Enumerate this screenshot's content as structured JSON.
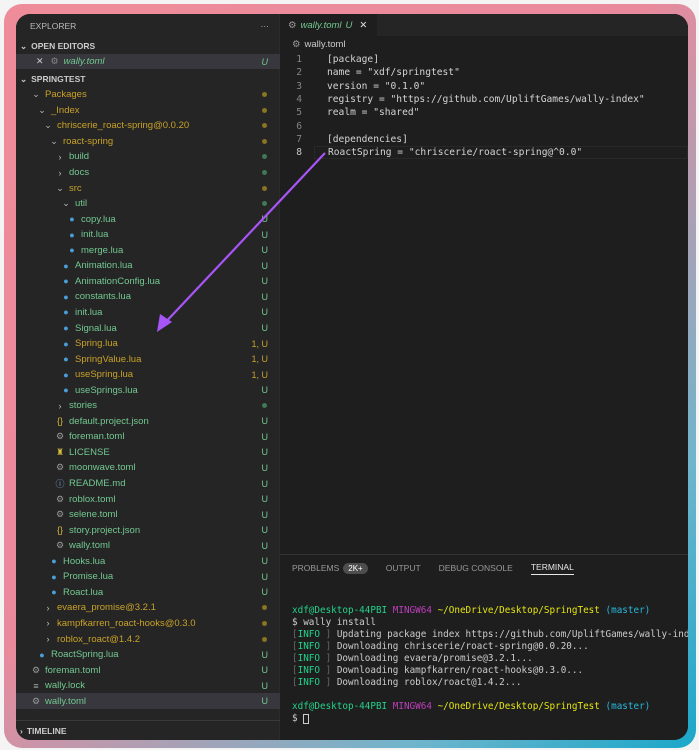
{
  "sidebar": {
    "title": "EXPLORER",
    "more": "···",
    "open_editors": "OPEN EDITORS",
    "open_file": {
      "name": "wally.toml",
      "badge": "U"
    },
    "workspace": "SPRINGTEST",
    "timeline": "TIMELINE",
    "tree": [
      {
        "name": "Packages",
        "lvl": 1,
        "kind": "folder-open",
        "color": "#c9a227",
        "dot": "#8a7420"
      },
      {
        "name": "_Index",
        "lvl": 2,
        "kind": "folder-open",
        "color": "#c9a227",
        "dot": "#8a7420"
      },
      {
        "name": "chriscerie_roact-spring@0.0.20",
        "lvl": 3,
        "kind": "folder-open",
        "color": "#c9a227",
        "dot": "#8a7420"
      },
      {
        "name": "roact-spring",
        "lvl": 4,
        "kind": "folder-open",
        "color": "#c9a227",
        "dot": "#8a7420"
      },
      {
        "name": "build",
        "lvl": 5,
        "kind": "folder",
        "color": "#73c991",
        "dot": "#3f7a55"
      },
      {
        "name": "docs",
        "lvl": 5,
        "kind": "folder",
        "color": "#73c991",
        "dot": "#3f7a55"
      },
      {
        "name": "src",
        "lvl": 5,
        "kind": "folder-open",
        "color": "#c9a227",
        "dot": "#8a7420"
      },
      {
        "name": "util",
        "lvl": 6,
        "kind": "folder-open",
        "color": "#73c991",
        "dot": "#3f7a55"
      },
      {
        "name": "copy.lua",
        "lvl": 7,
        "kind": "lua",
        "color": "#73c991",
        "badge": "U"
      },
      {
        "name": "init.lua",
        "lvl": 7,
        "kind": "lua",
        "color": "#73c991",
        "badge": "U"
      },
      {
        "name": "merge.lua",
        "lvl": 7,
        "kind": "lua",
        "color": "#73c991",
        "badge": "U"
      },
      {
        "name": "Animation.lua",
        "lvl": 6,
        "kind": "lua",
        "color": "#73c991",
        "badge": "U"
      },
      {
        "name": "AnimationConfig.lua",
        "lvl": 6,
        "kind": "lua",
        "color": "#73c991",
        "badge": "U"
      },
      {
        "name": "constants.lua",
        "lvl": 6,
        "kind": "lua",
        "color": "#73c991",
        "badge": "U"
      },
      {
        "name": "init.lua",
        "lvl": 6,
        "kind": "lua",
        "color": "#73c991",
        "badge": "U"
      },
      {
        "name": "Signal.lua",
        "lvl": 6,
        "kind": "lua",
        "color": "#73c991",
        "badge": "U"
      },
      {
        "name": "Spring.lua",
        "lvl": 6,
        "kind": "lua",
        "color": "#c9a227",
        "badge": "1, U"
      },
      {
        "name": "SpringValue.lua",
        "lvl": 6,
        "kind": "lua",
        "color": "#c9a227",
        "badge": "1, U"
      },
      {
        "name": "useSpring.lua",
        "lvl": 6,
        "kind": "lua",
        "color": "#c9a227",
        "badge": "1, U"
      },
      {
        "name": "useSprings.lua",
        "lvl": 6,
        "kind": "lua",
        "color": "#73c991",
        "badge": "U"
      },
      {
        "name": "stories",
        "lvl": 5,
        "kind": "folder",
        "color": "#73c991",
        "dot": "#3f7a55"
      },
      {
        "name": "default.project.json",
        "lvl": 5,
        "kind": "json",
        "color": "#73c991",
        "badge": "U"
      },
      {
        "name": "foreman.toml",
        "lvl": 5,
        "kind": "gear",
        "color": "#73c991",
        "badge": "U"
      },
      {
        "name": "LICENSE",
        "lvl": 5,
        "kind": "license",
        "color": "#73c991",
        "badge": "U"
      },
      {
        "name": "moonwave.toml",
        "lvl": 5,
        "kind": "gear",
        "color": "#73c991",
        "badge": "U"
      },
      {
        "name": "README.md",
        "lvl": 5,
        "kind": "info",
        "color": "#73c991",
        "badge": "U"
      },
      {
        "name": "roblox.toml",
        "lvl": 5,
        "kind": "gear",
        "color": "#73c991",
        "badge": "U"
      },
      {
        "name": "selene.toml",
        "lvl": 5,
        "kind": "gear",
        "color": "#73c991",
        "badge": "U"
      },
      {
        "name": "story.project.json",
        "lvl": 5,
        "kind": "json",
        "color": "#73c991",
        "badge": "U"
      },
      {
        "name": "wally.toml",
        "lvl": 5,
        "kind": "gear",
        "color": "#73c991",
        "badge": "U"
      },
      {
        "name": "Hooks.lua",
        "lvl": 4,
        "kind": "lua",
        "color": "#73c991",
        "badge": "U"
      },
      {
        "name": "Promise.lua",
        "lvl": 4,
        "kind": "lua",
        "color": "#73c991",
        "badge": "U"
      },
      {
        "name": "Roact.lua",
        "lvl": 4,
        "kind": "lua",
        "color": "#73c991",
        "badge": "U"
      },
      {
        "name": "evaera_promise@3.2.1",
        "lvl": 3,
        "kind": "folder",
        "color": "#c9a227",
        "dot": "#8a7420"
      },
      {
        "name": "kampfkarren_roact-hooks@0.3.0",
        "lvl": 3,
        "kind": "folder",
        "color": "#c9a227",
        "dot": "#8a7420"
      },
      {
        "name": "roblox_roact@1.4.2",
        "lvl": 3,
        "kind": "folder",
        "color": "#c9a227",
        "dot": "#8a7420"
      },
      {
        "name": "RoactSpring.lua",
        "lvl": 2,
        "kind": "lua",
        "color": "#73c991",
        "badge": "U"
      },
      {
        "name": "foreman.toml",
        "lvl": 1,
        "kind": "gear",
        "color": "#73c991",
        "badge": "U"
      },
      {
        "name": "wally.lock",
        "lvl": 1,
        "kind": "lines",
        "color": "#73c991",
        "badge": "U"
      },
      {
        "name": "wally.toml",
        "lvl": 1,
        "kind": "gear",
        "color": "#73c991",
        "badge": "U",
        "selected": true
      }
    ]
  },
  "editor": {
    "tab": {
      "name": "wally.toml",
      "badge": "U",
      "close": "✕"
    },
    "breadcrumb": "wally.toml",
    "lines": [
      "[package]",
      "name = \"xdf/springtest\"",
      "version = \"0.1.0\"",
      "registry = \"https://github.com/UpliftGames/wally-index\"",
      "realm = \"shared\"",
      "",
      "[dependencies]",
      "RoactSpring = \"chriscerie/roact-spring@^0.0\""
    ],
    "current_line": 8
  },
  "panel": {
    "tabs": [
      "PROBLEMS",
      "OUTPUT",
      "DEBUG CONSOLE",
      "TERMINAL"
    ],
    "problems_badge": "2K+",
    "active": "TERMINAL",
    "prompt": {
      "user": "xdf@Desktop-44PBI",
      "sys": "MINGW64",
      "path": "~/OneDrive/Desktop/SpringTest",
      "branch": "(master)"
    },
    "command": "$ wally install",
    "log": [
      {
        "level": "INFO",
        "msg": "Updating package index https://github.com/UpliftGames/wally-index..."
      },
      {
        "level": "INFO",
        "msg": "Downloading chriscerie/roact-spring@0.0.20..."
      },
      {
        "level": "INFO",
        "msg": "Downloading evaera/promise@3.2.1..."
      },
      {
        "level": "INFO",
        "msg": "Downloading kampfkarren/roact-hooks@0.3.0..."
      },
      {
        "level": "INFO",
        "msg": "Downloading roblox/roact@1.4.2..."
      }
    ],
    "final_prompt": "$ "
  },
  "colors": {
    "accent_arrow": "#a855f7",
    "git_untracked": "#73c991",
    "git_modified": "#c9a227"
  }
}
